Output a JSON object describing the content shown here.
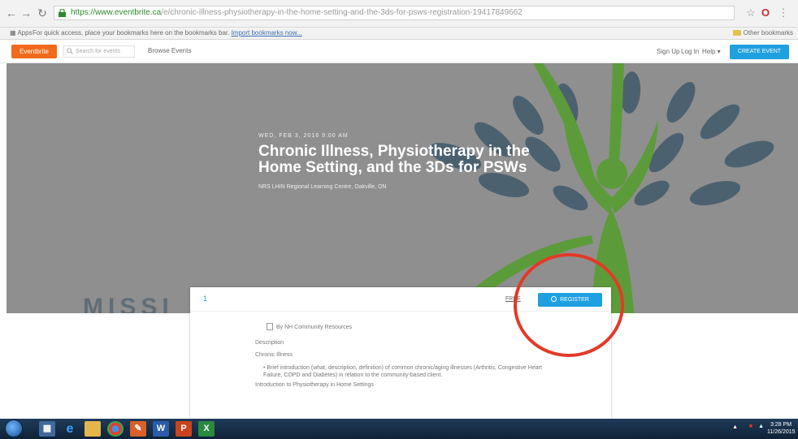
{
  "browser": {
    "url_prefix": "https://www.eventbrite.ca",
    "url_rest": "/e/chronic-illness-physiotherapy-in-the-home-setting-and-the-3ds-for-psws-registration-19417849662",
    "bookmarks_apps": "Apps",
    "bookmarks_message": "For quick access, place your bookmarks here on the bookmarks bar.",
    "bookmarks_import_link": "Import bookmarks now...",
    "other_bookmarks": "Other bookmarks"
  },
  "site_header": {
    "logo_text": "Eventbrite",
    "search_placeholder": "Search for events",
    "browse_label": "Browse Events",
    "signup_label": "Sign Up",
    "login_label": "Log In",
    "help_label": "Help",
    "create_event_label": "CREATE EVENT"
  },
  "hero": {
    "date": "WED, FEB 3, 2016 9:00 AM",
    "title": "Chronic Illness, Physiotherapy in the Home Setting, and the 3Ds for PSWs",
    "venue": "NRS LHIN Regional Learning Centre, Oakville, ON",
    "watermark": "MISSI"
  },
  "event_card": {
    "ticket_count": "1",
    "price_label": "FREE",
    "register_label": "REGISTER",
    "organizer": "By NH Community Resources",
    "description_heading": "Description",
    "agenda_label": "Chronic Illness",
    "bullet_text": "Brief introduction (what, description, definition) of common chronic/aging illnesses (Arthritis, Congestive Heart Failure, COPD and Diabetes) in relation to the community-based client.",
    "more_text": "Introduction to Physiotherapy in Home Settings"
  },
  "taskbar": {
    "icons": [
      "ie-icon",
      "explorer-icon",
      "chrome-icon",
      "paint-icon",
      "word-icon",
      "powerpoint-icon",
      "excel-icon"
    ],
    "time": "3:28 PM",
    "date": "11/26/2015"
  },
  "colors": {
    "hero_bg": "#8f8f8f",
    "tree_green": "#5c9b3a",
    "leaf_slate": "#4c6170",
    "brand_orange": "#f26a1b",
    "accent_blue": "#1fa0e0",
    "annotation_red": "#e23a27"
  }
}
